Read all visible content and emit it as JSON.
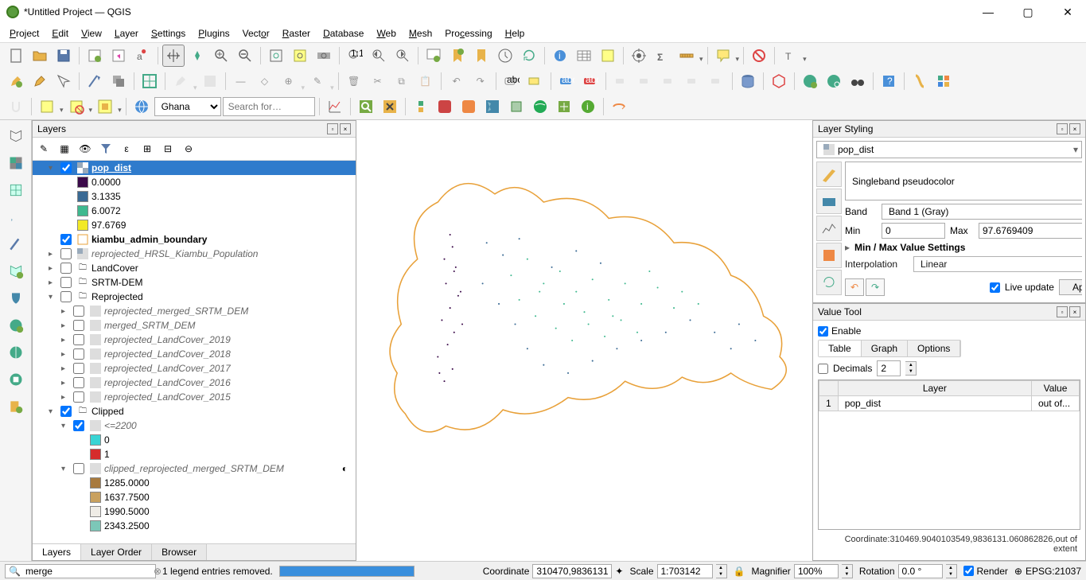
{
  "titlebar": {
    "title": "*Untitled Project — QGIS"
  },
  "menubar": [
    "Project",
    "Edit",
    "View",
    "Layer",
    "Settings",
    "Plugins",
    "Vector",
    "Raster",
    "Database",
    "Web",
    "Mesh",
    "Processing",
    "Help"
  ],
  "nominatim": {
    "region": "Ghana",
    "placeholder": "Search for…"
  },
  "layers_panel": {
    "title": "Layers",
    "tabs": [
      "Layers",
      "Layer Order",
      "Browser"
    ],
    "active_tab": "Layers"
  },
  "layer_tree": {
    "pop_dist": {
      "label": "pop_dist",
      "checked": true,
      "selected": true,
      "legend": [
        {
          "color": "#3b0a4a",
          "label": "0.0000"
        },
        {
          "color": "#3a6a94",
          "label": "3.1335"
        },
        {
          "color": "#3fb98f",
          "label": "6.0072"
        },
        {
          "color": "#f2e926",
          "label": "97.6769"
        }
      ]
    },
    "kiambu": {
      "label": "kiambu_admin_boundary",
      "checked": true
    },
    "reproj_pop": {
      "label": "reprojected_HRSL_Kiambu_Population"
    },
    "landcover": {
      "label": "LandCover"
    },
    "srtm": {
      "label": "SRTM-DEM"
    },
    "reprojected_group": {
      "label": "Reprojected",
      "expanded": true,
      "children": [
        "reprojected_merged_SRTM_DEM",
        "merged_SRTM_DEM",
        "reprojected_LandCover_2019",
        "reprojected_LandCover_2018",
        "reprojected_LandCover_2017",
        "reprojected_LandCover_2016",
        "reprojected_LandCover_2015"
      ]
    },
    "clipped_group": {
      "label": "Clipped",
      "expanded": true
    },
    "lte2200": {
      "label": "<=2200",
      "checked": true,
      "legend": [
        {
          "color": "#39d4d4",
          "label": "0"
        },
        {
          "color": "#d62c2c",
          "label": "1"
        }
      ]
    },
    "clipped_srtm": {
      "label": "clipped_reprojected_merged_SRTM_DEM",
      "legend": [
        {
          "color": "#a87a3e",
          "label": "1285.0000"
        },
        {
          "color": "#c9a15f",
          "label": "1637.7500"
        },
        {
          "color": "#efece6",
          "label": "1990.5000"
        },
        {
          "color": "#7cc7b8",
          "label": "2343.2500"
        }
      ]
    }
  },
  "layer_styling": {
    "title": "Layer Styling",
    "layer": "pop_dist",
    "renderer": "Singleband pseudocolor",
    "band": "Band 1 (Gray)",
    "min": "0",
    "max": "97.6769409",
    "minmax_label": "Min / Max Value Settings",
    "interpolation_label": "Interpolation",
    "interpolation": "Linear",
    "live_update": "Live update",
    "apply": "Apply",
    "band_label": "Band",
    "min_label": "Min",
    "max_label": "Max"
  },
  "value_tool": {
    "title": "Value Tool",
    "enable": "Enable",
    "tabs": [
      "Table",
      "Graph",
      "Options"
    ],
    "active_tab": "Table",
    "decimals_label": "Decimals",
    "decimals": "2",
    "headers": [
      "Layer",
      "Value"
    ],
    "row": {
      "n": "1",
      "layer": "pop_dist",
      "value": "out of..."
    },
    "coord": "Coordinate:310469.9040103549,9836131.060862826,out of extent"
  },
  "statusbar": {
    "search": "merge",
    "legend_msg": "1 legend entries removed.",
    "coordinate_label": "Coordinate",
    "coordinate": "310470,9836131",
    "scale_label": "Scale",
    "scale": "1:703142",
    "magnifier_label": "Magnifier",
    "magnifier": "100%",
    "rotation_label": "Rotation",
    "rotation": "0.0 °",
    "render": "Render",
    "crs": "EPSG:21037"
  }
}
